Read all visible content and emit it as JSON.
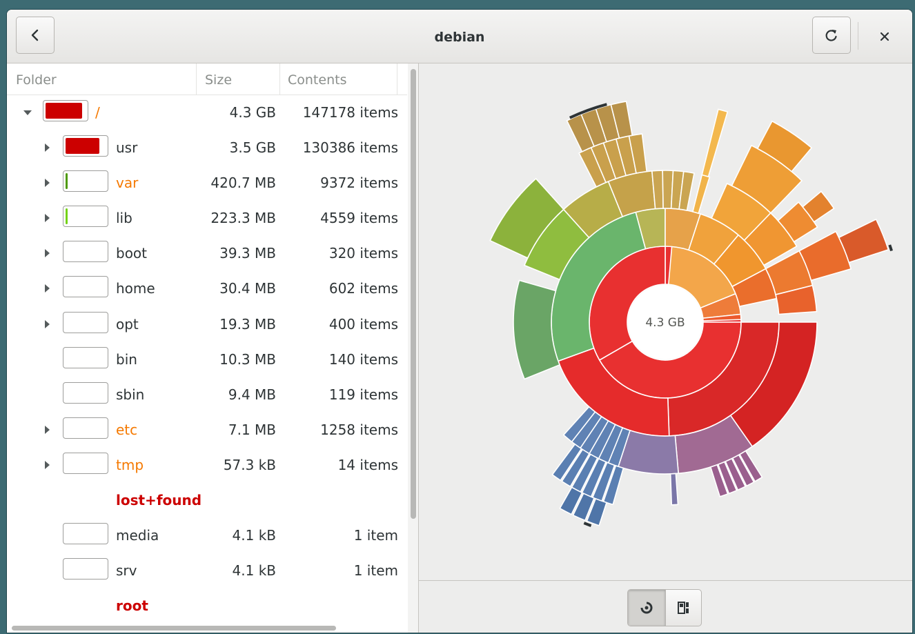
{
  "window": {
    "title": "debian"
  },
  "headerbar": {
    "back_icon": "go-previous-icon",
    "refresh_icon": "view-refresh-icon",
    "close_icon": "window-close-icon"
  },
  "columns": {
    "folder": "Folder",
    "size": "Size",
    "contents": "Contents"
  },
  "rows": [
    {
      "name": "/",
      "size": "4.3 GB",
      "contents": "147178 items",
      "depth": 0,
      "expander": "open",
      "usage": 0.88,
      "bar_color": "#cc0000",
      "name_color": "#f57900",
      "bold": false
    },
    {
      "name": "usr",
      "size": "3.5 GB",
      "contents": "130386 items",
      "depth": 1,
      "expander": "closed",
      "usage": 0.82,
      "bar_color": "#cc0000",
      "name_color": "#2e3436",
      "bold": false
    },
    {
      "name": "var",
      "size": "420.7 MB",
      "contents": "9372 items",
      "depth": 1,
      "expander": "closed",
      "usage": 0.05,
      "bar_color": "#4e9a06",
      "name_color": "#f57900",
      "bold": false
    },
    {
      "name": "lib",
      "size": "223.3 MB",
      "contents": "4559 items",
      "depth": 1,
      "expander": "closed",
      "usage": 0.03,
      "bar_color": "#73d216",
      "name_color": "#2e3436",
      "bold": false
    },
    {
      "name": "boot",
      "size": "39.3 MB",
      "contents": "320 items",
      "depth": 1,
      "expander": "closed",
      "usage": 0,
      "bar_color": "#73d216",
      "name_color": "#2e3436",
      "bold": false
    },
    {
      "name": "home",
      "size": "30.4 MB",
      "contents": "602 items",
      "depth": 1,
      "expander": "closed",
      "usage": 0,
      "bar_color": "#73d216",
      "name_color": "#2e3436",
      "bold": false
    },
    {
      "name": "opt",
      "size": "19.3 MB",
      "contents": "400 items",
      "depth": 1,
      "expander": "closed",
      "usage": 0,
      "bar_color": "#73d216",
      "name_color": "#2e3436",
      "bold": false
    },
    {
      "name": "bin",
      "size": "10.3 MB",
      "contents": "140 items",
      "depth": 1,
      "expander": "none",
      "usage": 0,
      "bar_color": "#73d216",
      "name_color": "#2e3436",
      "bold": false
    },
    {
      "name": "sbin",
      "size": "9.4 MB",
      "contents": "119 items",
      "depth": 1,
      "expander": "none",
      "usage": 0,
      "bar_color": "#73d216",
      "name_color": "#2e3436",
      "bold": false
    },
    {
      "name": "etc",
      "size": "7.1 MB",
      "contents": "1258 items",
      "depth": 1,
      "expander": "closed",
      "usage": 0,
      "bar_color": "#73d216",
      "name_color": "#f57900",
      "bold": false
    },
    {
      "name": "tmp",
      "size": "57.3 kB",
      "contents": "14 items",
      "depth": 1,
      "expander": "closed",
      "usage": 0,
      "bar_color": "#73d216",
      "name_color": "#f57900",
      "bold": false
    },
    {
      "name": "lost+found",
      "size": "",
      "contents": "",
      "depth": 1,
      "expander": "none",
      "no_bar": true,
      "usage": 0,
      "bar_color": "#73d216",
      "name_color": "#cc0000",
      "bold": true
    },
    {
      "name": "media",
      "size": "4.1 kB",
      "contents": "1 item",
      "depth": 1,
      "expander": "none",
      "usage": 0,
      "bar_color": "#73d216",
      "name_color": "#2e3436",
      "bold": false
    },
    {
      "name": "srv",
      "size": "4.1 kB",
      "contents": "1 item",
      "depth": 1,
      "expander": "none",
      "usage": 0,
      "bar_color": "#73d216",
      "name_color": "#2e3436",
      "bold": false
    },
    {
      "name": "root",
      "size": "",
      "contents": "",
      "depth": 1,
      "expander": "none",
      "no_bar": true,
      "usage": 0,
      "bar_color": "#73d216",
      "name_color": "#cc0000",
      "bold": true
    }
  ],
  "chart": {
    "center_label": "4.3 GB",
    "palette": {
      "usr": "#e83030",
      "var": "#6cae6c",
      "lib": "#9e6e9a",
      "lib2": "#7e78a8",
      "blue": "#5b80b0",
      "boot": "#f0a64a"
    }
  },
  "view_switcher": {
    "selected": "rings",
    "items": [
      "rings-chart-icon",
      "treemap-chart-icon"
    ]
  }
}
